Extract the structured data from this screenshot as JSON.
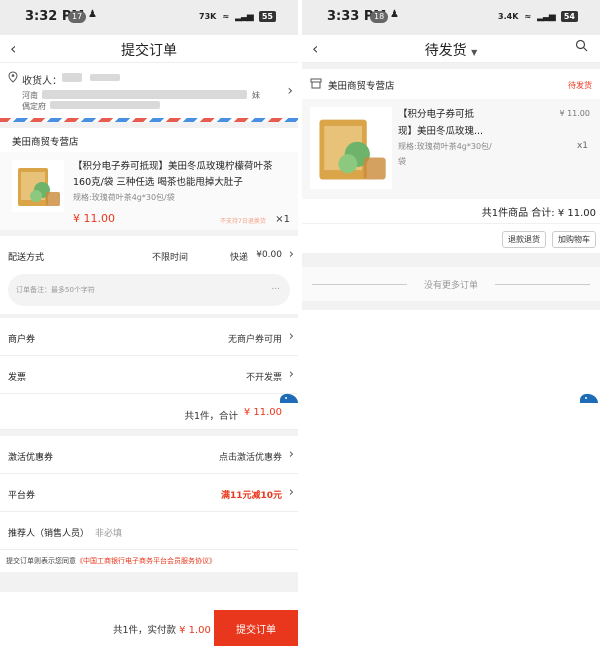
{
  "left": {
    "status_bar": {
      "time": "3:32 PM",
      "notif_count": "17",
      "speed": "73K",
      "battery": "55"
    },
    "nav": {
      "title": "提交订单"
    },
    "address": {
      "label": "收货人：",
      "name_tail": "",
      "line1_start": "河南",
      "line2_start": "偶定府",
      "line1_end": "妹"
    },
    "store": "美田商贸专营店",
    "product": {
      "title": "【积分电子券可抵现】美田冬瓜玫瑰柠檬荷叶茶160克/袋 三种任选 喝茶也能甩掉大肚子",
      "spec": "规格:玫瑰荷叶茶4g*30包/袋",
      "price": "¥ 11.00",
      "note": "不支持7日退换货",
      "qty": "×1"
    },
    "shipping": {
      "label": "配送方式",
      "time": "不限时间",
      "method": "快递",
      "price": "¥0.00"
    },
    "remark_placeholder": "订单备注：最多50个字符",
    "remark_dots": "...",
    "merchant_coupon": {
      "label": "商户券",
      "value": "无商户券可用"
    },
    "invoice": {
      "label": "发票",
      "value": "不开发票"
    },
    "subtotal": {
      "text": "共1件，合计",
      "amount": "¥ 11.00"
    },
    "activate_coupon": {
      "label": "激活优惠券",
      "value": "点击激活优惠券"
    },
    "platform_coupon": {
      "label": "平台券",
      "value": "满11元减10元"
    },
    "referrer": {
      "label": "推荐人（销售人员）",
      "placeholder": "非必填"
    },
    "agreement": {
      "text": "提交订单则表示您同意",
      "link": "《中国工商银行电子商务平台会员服务协议》"
    },
    "bottom": {
      "summary": "共1件，实付款",
      "price": "¥ 1.00",
      "submit": "提交订单"
    }
  },
  "right": {
    "status_bar": {
      "time": "3:33 PM",
      "notif_count": "18",
      "speed": "3.4K",
      "battery": "54"
    },
    "nav": {
      "title": "待发货"
    },
    "order": {
      "store": "美田商贸专营店",
      "status": "待发货",
      "title_line1": "【积分电子券可抵",
      "title_line2": "现】美田冬瓜玫瑰...",
      "spec": "规格:玫瑰荷叶茶4g*30包/袋",
      "price": "¥ 11.00",
      "qty": "x1",
      "total": "共1件商品 合计: ¥ 11.00",
      "refund_button": "退款退货",
      "cart_button": "加购物车"
    },
    "no_more": "没有更多订单"
  },
  "colors": {
    "accent": "#e8371c",
    "background": "#f2f2f2"
  }
}
